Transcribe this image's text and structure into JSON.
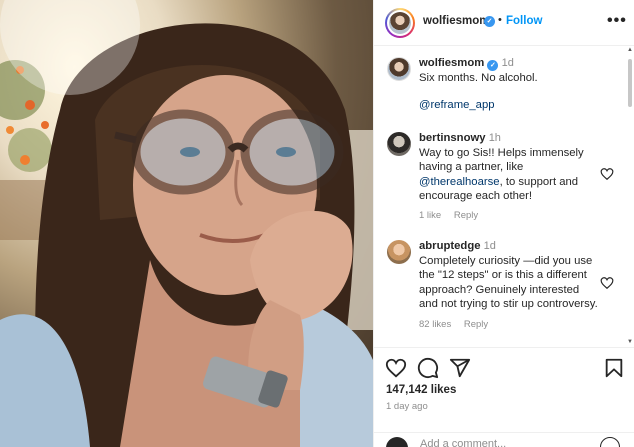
{
  "post": {
    "author": "wolfiesmom",
    "follow_label": "Follow",
    "separator": "•",
    "caption_time": "1d",
    "caption_text": "Six months. No alcohol.",
    "caption_mention": "@reframe_app"
  },
  "comments": [
    {
      "username": "bertinsnowy",
      "time": "1h",
      "text_before": "Way to go Sis!! Helps immensely having a partner, like",
      "mention": "@therealhoarse",
      "text_after": ", to support and encourage each other!",
      "likes": "1 like",
      "reply_label": "Reply"
    },
    {
      "username": "abruptedge",
      "time": "1d",
      "text": "Completely curiosity —did you use the \"12 steps\" or is this a different approach? Genuinely interested and not trying to stir up controversy.",
      "likes": "82 likes",
      "reply_label": "Reply"
    }
  ],
  "stats": {
    "likes": "147,142 likes",
    "ago": "1 day ago"
  },
  "add_comment_placeholder": "Add a comment...",
  "icons": [
    "verified-badge-icon",
    "more-options-icon",
    "heart-icon",
    "comment-icon",
    "share-icon",
    "bookmark-icon",
    "emoji-icon"
  ],
  "colors": {
    "link": "#0095f6",
    "mention": "#00376b",
    "muted": "#8e8e8e",
    "verified": "#3897f0"
  }
}
